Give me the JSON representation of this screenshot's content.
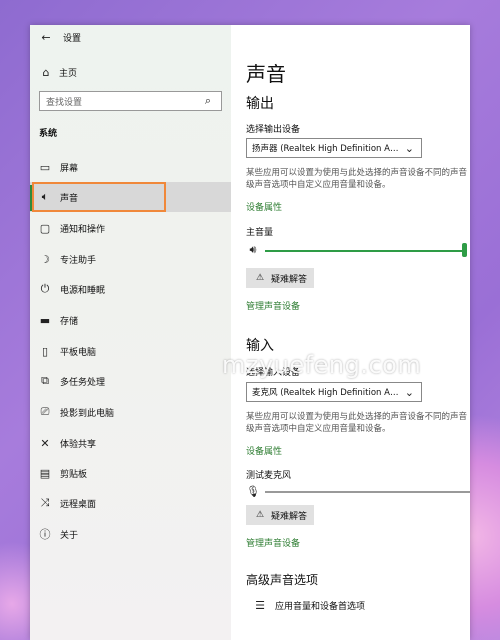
{
  "window": {
    "title": "设置"
  },
  "sidebar": {
    "home_label": "主页",
    "search_placeholder": "查找设置",
    "section_label": "系统",
    "items": [
      {
        "label": "屏幕",
        "icon": "monitor-icon"
      },
      {
        "label": "声音",
        "icon": "speaker-icon",
        "active": true
      },
      {
        "label": "通知和操作",
        "icon": "notification-icon"
      },
      {
        "label": "专注助手",
        "icon": "moon-icon"
      },
      {
        "label": "电源和睡眠",
        "icon": "power-icon"
      },
      {
        "label": "存储",
        "icon": "storage-icon"
      },
      {
        "label": "平板电脑",
        "icon": "tablet-icon"
      },
      {
        "label": "多任务处理",
        "icon": "multitask-icon"
      },
      {
        "label": "投影到此电脑",
        "icon": "project-icon"
      },
      {
        "label": "体验共享",
        "icon": "share-icon"
      },
      {
        "label": "剪贴板",
        "icon": "clipboard-icon"
      },
      {
        "label": "远程桌面",
        "icon": "remote-icon"
      },
      {
        "label": "关于",
        "icon": "info-icon"
      }
    ]
  },
  "main": {
    "title": "声音",
    "output": {
      "heading": "输出",
      "device_label": "选择输出设备",
      "device_value": "扬声器 (Realtek High Definition Audi...",
      "description_line1": "某些应用可以设置为使用与此处选择的声音设备不同的声音",
      "description_line2": "级声音选项中自定义应用音量和设备。",
      "properties_link": "设备属性",
      "volume_label": "主音量",
      "volume_level": 1.0,
      "troubleshoot_label": "疑难解答",
      "manage_link": "管理声音设备"
    },
    "input": {
      "heading": "输入",
      "device_label": "选择输入设备",
      "device_value": "麦克风 (Realtek High Definition Audi...",
      "description_line1": "某些应用可以设置为使用与此处选择的声音设备不同的声音",
      "description_line2": "级声音选项中自定义应用音量和设备。",
      "properties_link": "设备属性",
      "test_label": "测试麦克风",
      "mic_level": 0.0,
      "troubleshoot_label": "疑难解答",
      "manage_link": "管理声音设备"
    },
    "advanced": {
      "heading": "高级声音选项",
      "app_volume_label": "应用音量和设备首选项"
    }
  },
  "watermark": "mzyuefeng.com",
  "colors": {
    "accent": "#2e9c46",
    "highlight": "#f0883a",
    "link": "#2e7d32"
  }
}
